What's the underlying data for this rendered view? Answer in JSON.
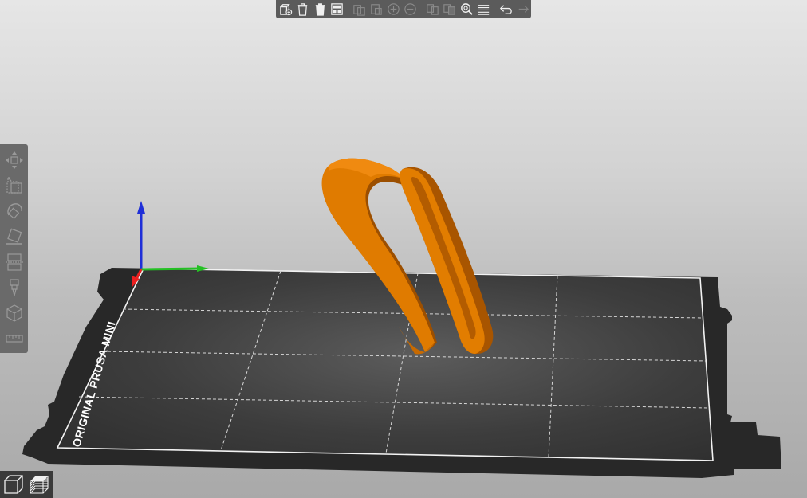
{
  "bed": {
    "label": "ORIGINAL PRUSA MINI"
  },
  "top_toolbar": {
    "buttons": [
      {
        "name": "add-icon",
        "enabled": true
      },
      {
        "name": "delete-icon",
        "enabled": true
      },
      {
        "name": "delete-all-icon",
        "enabled": true
      },
      {
        "name": "arrange-icon",
        "enabled": true
      },
      {
        "name": "copy-icon",
        "enabled": false
      },
      {
        "name": "paste-icon",
        "enabled": false
      },
      {
        "name": "add-instance-icon",
        "enabled": false
      },
      {
        "name": "remove-instance-icon",
        "enabled": false
      },
      {
        "name": "split-objects-icon",
        "enabled": false
      },
      {
        "name": "split-parts-icon",
        "enabled": false
      },
      {
        "name": "search-icon",
        "enabled": true
      },
      {
        "name": "layers-editing-icon",
        "enabled": true
      },
      {
        "name": "undo-icon",
        "enabled": true
      },
      {
        "name": "redo-icon",
        "enabled": false
      }
    ]
  },
  "left_toolbar": {
    "tools": [
      "move-icon",
      "scale-icon",
      "rotate-icon",
      "place-on-face-icon",
      "cut-icon",
      "paint-supports-icon",
      "seam-painting-icon",
      "measure-icon"
    ]
  },
  "view_toggle": {
    "active": "3d-view-icon",
    "items": [
      "3d-view-icon",
      "preview-layers-icon"
    ]
  },
  "colors": {
    "model": "#e07b00",
    "bed_surface": "#3e3e3e",
    "bed_frame": "#2a2a2a",
    "grid": "#d0d0d0",
    "axis_x": "#ff2020",
    "axis_y": "#20c020",
    "axis_z": "#2030d0"
  }
}
